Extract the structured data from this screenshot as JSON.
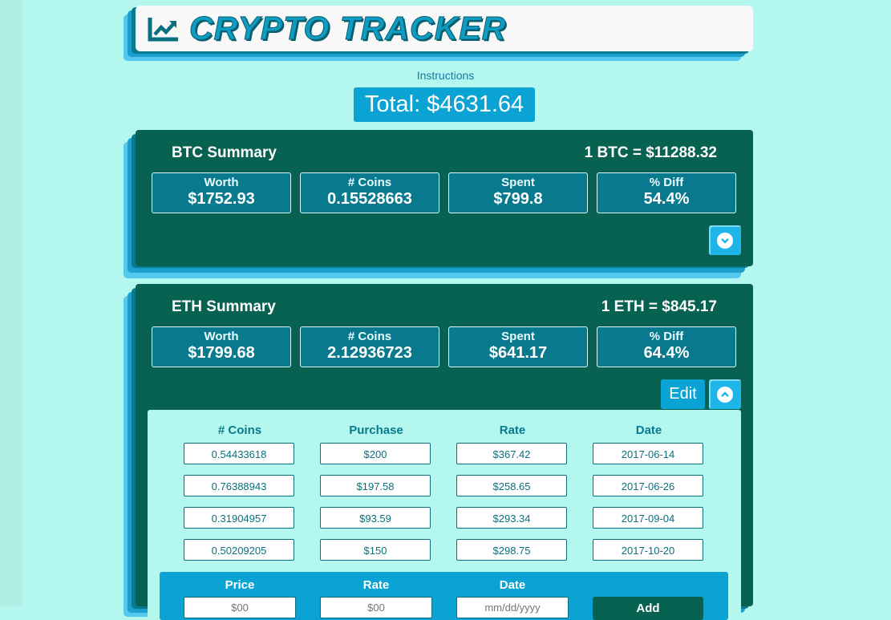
{
  "app": {
    "title": "CRYPTO TRACKER"
  },
  "instructions_label": "Instructions",
  "total_label": "Total: $4631.64",
  "btc": {
    "title": "BTC Summary",
    "rate": "1 BTC = $11288.32",
    "stats": [
      {
        "label": "Worth",
        "value": "$1752.93"
      },
      {
        "label": "# Coins",
        "value": "0.15528663"
      },
      {
        "label": "Spent",
        "value": "$799.8"
      },
      {
        "label": "% Diff",
        "value": "54.4%"
      }
    ]
  },
  "eth": {
    "title": "ETH Summary",
    "rate": "1 ETH = $845.17",
    "stats": [
      {
        "label": "Worth",
        "value": "$1799.68"
      },
      {
        "label": "# Coins",
        "value": "2.12936723"
      },
      {
        "label": "Spent",
        "value": "$641.17"
      },
      {
        "label": "% Diff",
        "value": "64.4%"
      }
    ],
    "edit_label": "Edit",
    "columns": [
      "# Coins",
      "Purchase",
      "Rate",
      "Date"
    ],
    "rows": [
      [
        "0.54433618",
        "$200",
        "$367.42",
        "2017-06-14"
      ],
      [
        "0.76388943",
        "$197.58",
        "$258.65",
        "2017-06-26"
      ],
      [
        "0.31904957",
        "$93.59",
        "$293.34",
        "2017-09-04"
      ],
      [
        "0.50209205",
        "$150",
        "$298.75",
        "2017-10-20"
      ]
    ],
    "add_form": {
      "columns": [
        "Price",
        "Rate",
        "Date"
      ],
      "price_placeholder": "$00",
      "rate_placeholder": "$00",
      "date_placeholder": "mm/dd/yyyy",
      "add_label": "Add"
    }
  },
  "icons": {
    "logo": "chart-line-icon",
    "collapse": "chevron-down-icon",
    "expand": "chevron-up-icon"
  }
}
